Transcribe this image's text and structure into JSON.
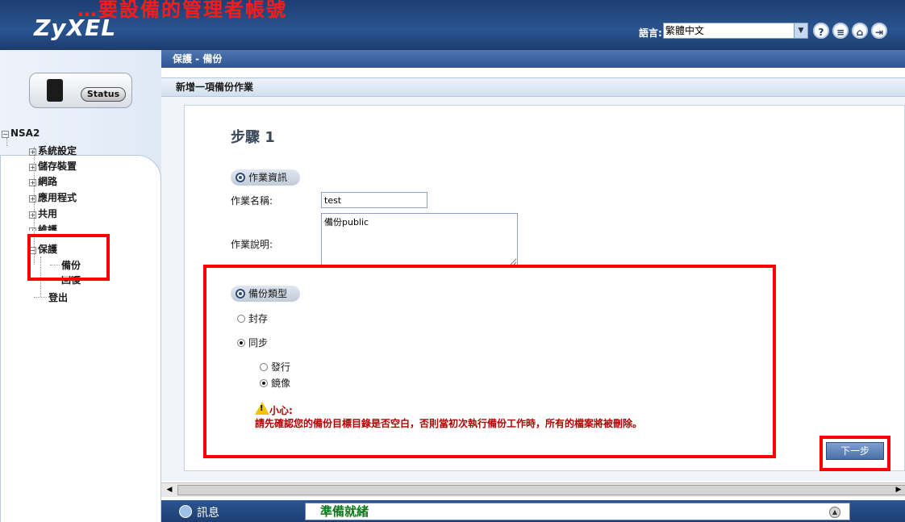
{
  "header": {
    "overlay_text": "…要設備的管理者帳號",
    "logo": "ZyXEL",
    "language_label": "語言:",
    "language_selected": "繁體中文",
    "icons": [
      "help-icon",
      "notes-icon",
      "home-icon",
      "logout-icon"
    ]
  },
  "sidebar": {
    "status_button": "Status",
    "tree": {
      "root": "NSA2",
      "items": [
        "系統設定",
        "儲存裝置",
        "網路",
        "應用程式",
        "共用",
        "維護",
        "保護",
        "備份",
        "回復",
        "登出"
      ]
    }
  },
  "breadcrumb": "保護 - 備份",
  "subheader": "新增一項備份作業",
  "step": {
    "title": "步驟 1",
    "job_info_section": "作業資訊",
    "job_name_label": "作業名稱:",
    "job_name_value": "test",
    "job_desc_label": "作業說明:",
    "job_desc_value": "備份public",
    "backup_type_section": "備份類型",
    "options": {
      "archive": "封存",
      "sync": "同步",
      "publish": "發行",
      "mirror": "鏡像"
    },
    "warning_title": "小心:",
    "warning_text": "請先確認您的備份目標目錄是否空白，否則當初次執行備份工作時，所有的檔案將被刪除。",
    "next_button": "下一步"
  },
  "footer": {
    "message_label": "訊息",
    "status_text": "準備就緒"
  },
  "colors": {
    "header_blue": "#1e3d72",
    "highlight_red": "#ff0000",
    "warning_text": "#b00000",
    "status_green": "#0a7a1a"
  }
}
